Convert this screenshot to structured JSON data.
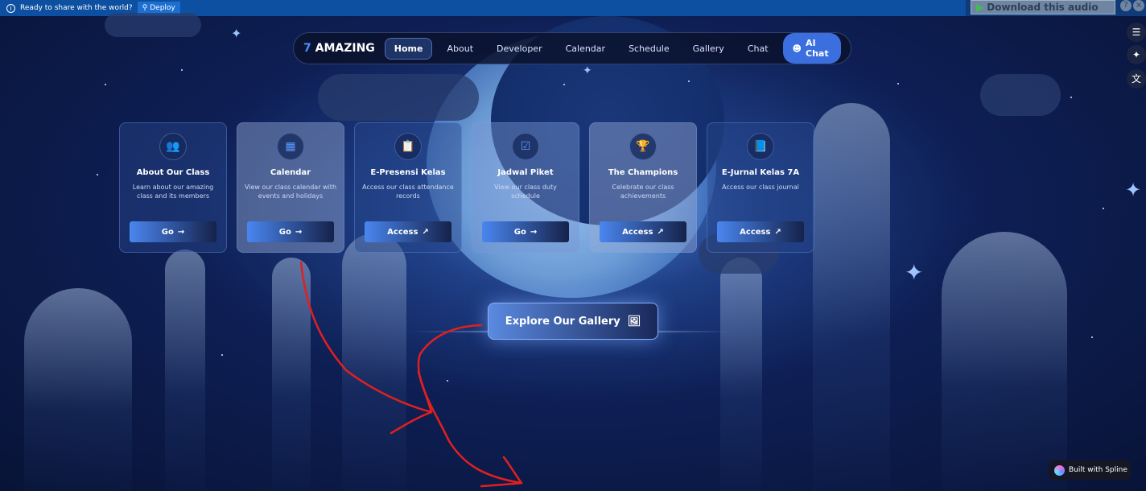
{
  "topbar": {
    "message": "Ready to share with the world?",
    "deploy_label": "Deploy"
  },
  "audio": {
    "download_label": "Download this audio",
    "help": "?",
    "close": "×"
  },
  "nav": {
    "brand_number": "7",
    "brand_name": "AMAZING",
    "items": [
      "Home",
      "About",
      "Developer",
      "Calendar",
      "Schedule",
      "Gallery",
      "Chat"
    ],
    "active": "Home",
    "ai_label": "AI Chat"
  },
  "cards": [
    {
      "icon": "users-icon",
      "title": "About Our Class",
      "desc": "Learn about our amazing class and its members",
      "button": "Go",
      "button_icon": "arrow-right-icon"
    },
    {
      "icon": "calendar-icon",
      "title": "Calendar",
      "desc": "View our class calendar with events and holidays",
      "button": "Go",
      "button_icon": "arrow-right-icon"
    },
    {
      "icon": "clipboard-icon",
      "title": "E-Presensi Kelas",
      "desc": "Access our class attendance records",
      "button": "Access",
      "button_icon": "external-link-icon"
    },
    {
      "icon": "calendar-check-icon",
      "title": "Jadwal Piket",
      "desc": "View our class duty schedule",
      "button": "Go",
      "button_icon": "arrow-right-icon"
    },
    {
      "icon": "trophy-icon",
      "title": "The Champions",
      "desc": "Celebrate our class achievements",
      "button": "Access",
      "button_icon": "external-link-icon"
    },
    {
      "icon": "book-icon",
      "title": "E-Jurnal Kelas 7A",
      "desc": "Access our class journal",
      "button": "Access",
      "button_icon": "external-link-icon"
    }
  ],
  "explore": {
    "label": "Explore Our Gallery",
    "icon": "images-icon"
  },
  "spline": {
    "label": "Built with Spline"
  },
  "annotation": {
    "color": "#e0201f",
    "shape": "red hand-drawn arrow"
  }
}
